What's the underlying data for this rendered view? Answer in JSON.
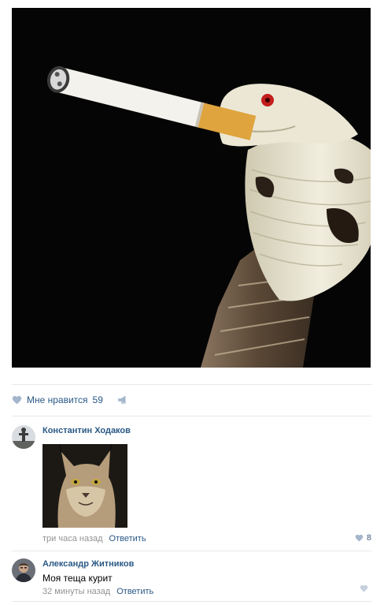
{
  "post": {
    "like_label": "Мне нравится",
    "like_count": "59"
  },
  "comments": [
    {
      "author": "Константин Ходаков",
      "text": "",
      "time": "три часа назад",
      "reply_label": "Ответить",
      "likes": "8"
    },
    {
      "author": "Александр Житников",
      "text": "Моя теща курит",
      "time": "32 минуты назад",
      "reply_label": "Ответить",
      "likes": ""
    }
  ],
  "colors": {
    "link": "#2a5885",
    "meta": "#939393",
    "like_icon": "#a5b6cc",
    "divider": "#e7e8ec"
  },
  "icons": {
    "like": "heart-icon",
    "share": "megaphone-icon"
  }
}
